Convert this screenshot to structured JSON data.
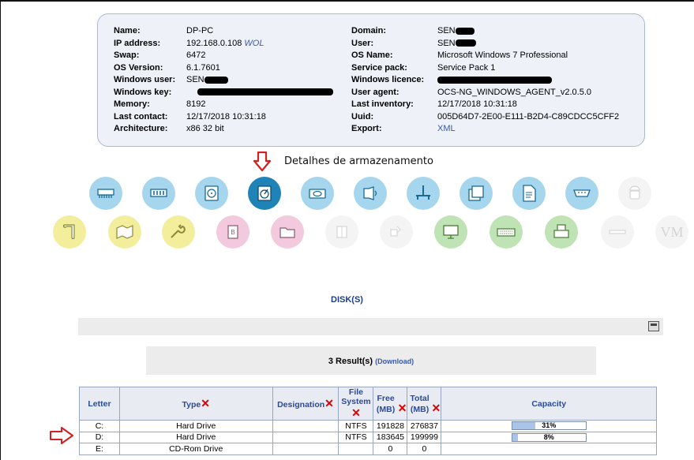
{
  "info": {
    "left": [
      {
        "label": "Name:",
        "value": "DP-PC"
      },
      {
        "label": "IP address:",
        "value": "192.168.0.108",
        "link": "WOL"
      },
      {
        "label": "Swap:",
        "value": "6472"
      },
      {
        "label": "OS Version:",
        "value": "6.1.7601"
      },
      {
        "label": "Windows user:",
        "value": "SEN"
      },
      {
        "label": "Windows key:",
        "value": ""
      },
      {
        "label": "Memory:",
        "value": "8192"
      },
      {
        "label": "Last contact:",
        "value": "12/17/2018 10:31:18"
      },
      {
        "label": "Architecture:",
        "value": "x86 32 bit"
      }
    ],
    "right": [
      {
        "label": "Domain:",
        "value": "SEN"
      },
      {
        "label": "User:",
        "value": "SEN"
      },
      {
        "label": "OS Name:",
        "value": "Microsoft Windows 7 Professional"
      },
      {
        "label": "Service pack:",
        "value": "Service Pack 1"
      },
      {
        "label": "Windows licence:",
        "value": ""
      },
      {
        "label": "User agent:",
        "value": "OCS-NG_WINDOWS_AGENT_v2.0.5.0"
      },
      {
        "label": "Last inventory:",
        "value": "12/17/2018 10:31:18"
      },
      {
        "label": "Uuid:",
        "value": "005D64D7-2E00-E111-B2D4-C89CDCC5CFF2"
      },
      {
        "label": "Export:",
        "value": "",
        "link": "XML"
      }
    ]
  },
  "annotation": "Detalhes de armazenamento",
  "icons_row1": [
    {
      "name": "network-icon",
      "color": "blue"
    },
    {
      "name": "memory-icon",
      "color": "blue"
    },
    {
      "name": "storage-icon",
      "color": "blue"
    },
    {
      "name": "disk-icon",
      "color": "blue-active"
    },
    {
      "name": "drive-icon",
      "color": "blue"
    },
    {
      "name": "audio-icon",
      "color": "blue"
    },
    {
      "name": "bus-icon",
      "color": "blue"
    },
    {
      "name": "files-icon",
      "color": "blue"
    },
    {
      "name": "document-icon",
      "color": "blue"
    },
    {
      "name": "port-icon",
      "color": "blue"
    },
    {
      "name": "android-icon",
      "color": "grey"
    }
  ],
  "icons_row2": [
    {
      "name": "scroll-icon",
      "color": "yellow"
    },
    {
      "name": "map-icon",
      "color": "yellow"
    },
    {
      "name": "wrench-icon",
      "color": "yellow"
    },
    {
      "name": "bios-icon",
      "color": "pink"
    },
    {
      "name": "folder-icon",
      "color": "pink"
    },
    {
      "name": "package-icon",
      "color": "grey"
    },
    {
      "name": "grid-icon",
      "color": "grey"
    },
    {
      "name": "monitor-icon",
      "color": "green"
    },
    {
      "name": "keyboard-icon",
      "color": "green"
    },
    {
      "name": "printer-icon",
      "color": "green"
    },
    {
      "name": "slot-icon",
      "color": "grey"
    },
    {
      "name": "vm-icon",
      "color": "grey",
      "text": "VM"
    }
  ],
  "disks": {
    "title": "DISK(S)",
    "results": "3 Result(s)",
    "download": "(Download)",
    "columns": [
      "Letter",
      "Type",
      "Designation",
      "File System",
      "Free (MB)",
      "Total (MB)",
      "Capacity"
    ],
    "rows": [
      {
        "letter": "C:",
        "type": "Hard Drive",
        "designation": "",
        "fs": "NTFS",
        "free": "191828",
        "total": "276837",
        "capacity": "31%",
        "capacity_value": 31
      },
      {
        "letter": "D:",
        "type": "Hard Drive",
        "designation": "",
        "fs": "NTFS",
        "free": "183645",
        "total": "199999",
        "capacity": "8%",
        "capacity_value": 8
      },
      {
        "letter": "E:",
        "type": "CD-Rom Drive",
        "designation": "",
        "fs": "",
        "free": "0",
        "total": "0",
        "capacity": "",
        "capacity_value": null
      }
    ]
  },
  "colors": {
    "link": "#3a59a8",
    "header_text": "#2a4a9c",
    "arrow": "#d42020"
  }
}
